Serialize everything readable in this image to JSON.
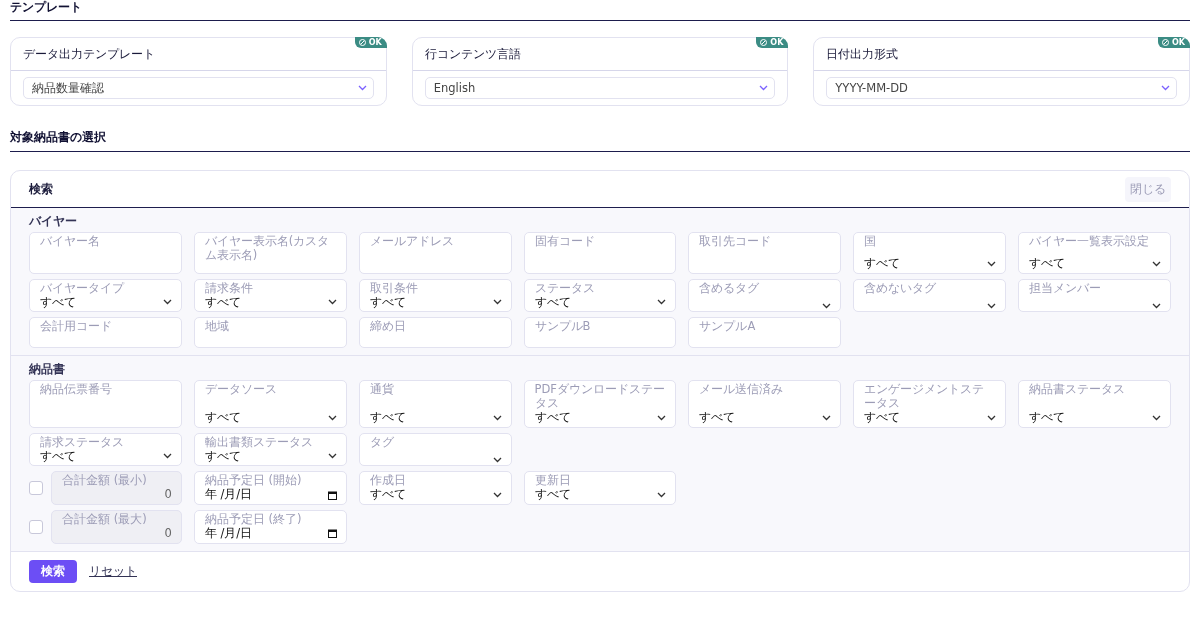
{
  "template_heading": "テンプレート",
  "template_cards": [
    {
      "title": "データ出力テンプレート",
      "badge": "OK",
      "value": "納品数量確認"
    },
    {
      "title": "行コンテンツ言語",
      "badge": "OK",
      "value": "English"
    },
    {
      "title": "日付出力形式",
      "badge": "OK",
      "value": "YYYY-MM-DD"
    }
  ],
  "selection_heading": "対象納品書の選択",
  "search_panel": {
    "title": "検索",
    "close_button": "閉じる",
    "sections": [
      {
        "title": "バイヤー",
        "rows": [
          [
            {
              "kind": "text",
              "label": "バイヤー名"
            },
            {
              "kind": "text",
              "label": "バイヤー表示名(カスタム表示名)"
            },
            {
              "kind": "text",
              "label": "メールアドレス"
            },
            {
              "kind": "text",
              "label": "固有コード"
            },
            {
              "kind": "text",
              "label": "取引先コード"
            },
            {
              "kind": "select",
              "label": "国",
              "value": "すべて"
            },
            {
              "kind": "select",
              "label": "バイヤー一覧表示設定",
              "value": "すべて"
            }
          ],
          [
            {
              "kind": "select",
              "label": "バイヤータイプ",
              "value": "すべて"
            },
            {
              "kind": "select",
              "label": "請求条件",
              "value": "すべて"
            },
            {
              "kind": "select",
              "label": "取引条件",
              "value": "すべて"
            },
            {
              "kind": "select",
              "label": "ステータス",
              "value": "すべて"
            },
            {
              "kind": "select",
              "label": "含めるタグ"
            },
            {
              "kind": "select",
              "label": "含めないタグ"
            },
            {
              "kind": "select",
              "label": "担当メンバー"
            }
          ],
          [
            {
              "kind": "text",
              "label": "会計用コード"
            },
            {
              "kind": "text",
              "label": "地域"
            },
            {
              "kind": "text",
              "label": "締め日"
            },
            {
              "kind": "text",
              "label": "サンプルB"
            },
            {
              "kind": "text",
              "label": "サンプルA"
            }
          ]
        ]
      },
      {
        "title": "納品書",
        "rows": [
          [
            {
              "kind": "text",
              "label": "納品伝票番号"
            },
            {
              "kind": "select",
              "label": "データソース",
              "value": "すべて"
            },
            {
              "kind": "select",
              "label": "通貨",
              "value": "すべて"
            },
            {
              "kind": "select",
              "label": "PDFダウンロードステータス",
              "value": "すべて"
            },
            {
              "kind": "select",
              "label": "メール送信済み",
              "value": "すべて"
            },
            {
              "kind": "select",
              "label": "エンゲージメントステータス",
              "value": "すべて"
            },
            {
              "kind": "select",
              "label": "納品書ステータス",
              "value": "すべて"
            }
          ],
          [
            {
              "kind": "select",
              "label": "請求ステータス",
              "value": "すべて"
            },
            {
              "kind": "select",
              "label": "輸出書類ステータス",
              "value": "すべて"
            },
            {
              "kind": "select",
              "label": "タグ"
            }
          ],
          [
            {
              "kind": "amount",
              "label": "合計金額 (最小)",
              "value": "0",
              "checked": false
            },
            {
              "kind": "date",
              "label": "納品予定日 (開始)",
              "value": "年 /月/日"
            },
            {
              "kind": "select",
              "label": "作成日",
              "value": "すべて"
            },
            {
              "kind": "select",
              "label": "更新日",
              "value": "すべて"
            }
          ],
          [
            {
              "kind": "amount",
              "label": "合計金額 (最大)",
              "value": "0",
              "checked": false
            },
            {
              "kind": "date",
              "label": "納品予定日 (終了)",
              "value": "年 /月/日"
            }
          ]
        ]
      }
    ],
    "search_button": "検索",
    "reset_link": "リセット"
  }
}
